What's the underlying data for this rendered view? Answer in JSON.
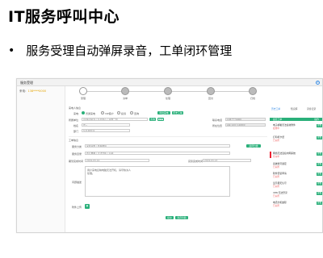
{
  "slide": {
    "title": "IT服务呼叫中心",
    "bullet_marker": "•",
    "bullet_text": "服务受理自动弹屏录音，工单闭环管理"
  },
  "app": {
    "window_title": "服务受理",
    "close_icon": "close-icon",
    "sidebar": [
      {
        "prefix": "来电：",
        "highlight": "138****0000"
      }
    ],
    "steps": [
      {
        "label": "受理",
        "active": true
      },
      {
        "label": "派单",
        "active": false
      },
      {
        "label": "处理",
        "active": false
      },
      {
        "label": "回访",
        "active": false
      },
      {
        "label": "归档",
        "active": false
      }
    ],
    "form": {
      "section_label": "来电人信息",
      "type_label": "来电:",
      "radios": [
        "普通来电",
        "VIP客户",
        "投诉",
        "咨询"
      ],
      "tab_buttons": [
        "呼出来电",
        "历史工单"
      ],
      "buttons_top": [
        "查询",
        "新增"
      ],
      "row1": {
        "label": "所属单位",
        "value": "XX集团总部 / 信息中心 / 运维一组",
        "label2": "联系电话",
        "value2": "138****0000"
      },
      "row2": {
        "label": "姓名",
        "value": "张三",
        "label2": "所在位置",
        "value2": "A座 12层 1208室"
      },
      "row3": {
        "label": "部门",
        "value": "信息技术部"
      },
      "section2": "工单信息",
      "f1": {
        "label": "服务分类",
        "value": "桌面运维 / 终端故障",
        "btn": "选择分类"
      },
      "f2": {
        "label": "服务目录",
        "value": "办公电脑 / 无法开机 / 蓝屏"
      },
      "f3": {
        "label": "期望完成时间",
        "value": "2019-03-12",
        "label2": "实际完成时间",
        "value2": "2019-03-13"
      },
      "f4": {
        "label": "问题描述",
        "value": "用户来电反映电脑无法开机，请尽快派人处理。"
      },
      "f5": {
        "label": "附件上传"
      },
      "submit": "提交",
      "save": "暂存草稿"
    },
    "right": {
      "tabs": [
        "历史工单",
        "知识库",
        "录音记录"
      ],
      "header": "最近工单",
      "header_btn": "操作",
      "items": [
        {
          "title": "电子邮箱无法接收附件",
          "sub": "处理中",
          "btn": "查看",
          "flag": false
        },
        {
          "title": "打印机卡纸",
          "sub": "已关闭",
          "btn": "查看",
          "flag": false
        },
        {
          "title": "网络无法连接内网系统",
          "sub": "待派单",
          "btn": "查看",
          "flag": true
        },
        {
          "title": "系统账号锁定",
          "sub": "已关闭",
          "btn": "查看",
          "flag": false
        },
        {
          "title": "软件安装申请",
          "sub": "已关闭",
          "btn": "查看",
          "flag": false
        },
        {
          "title": "显示器无信号",
          "sub": "已关闭",
          "btn": "查看",
          "flag": false
        },
        {
          "title": "VPN 无法登录",
          "sub": "已关闭",
          "btn": "查看",
          "flag": false
        },
        {
          "title": "电话分机故障",
          "sub": "已关闭",
          "btn": "查看",
          "flag": false
        }
      ]
    }
  }
}
